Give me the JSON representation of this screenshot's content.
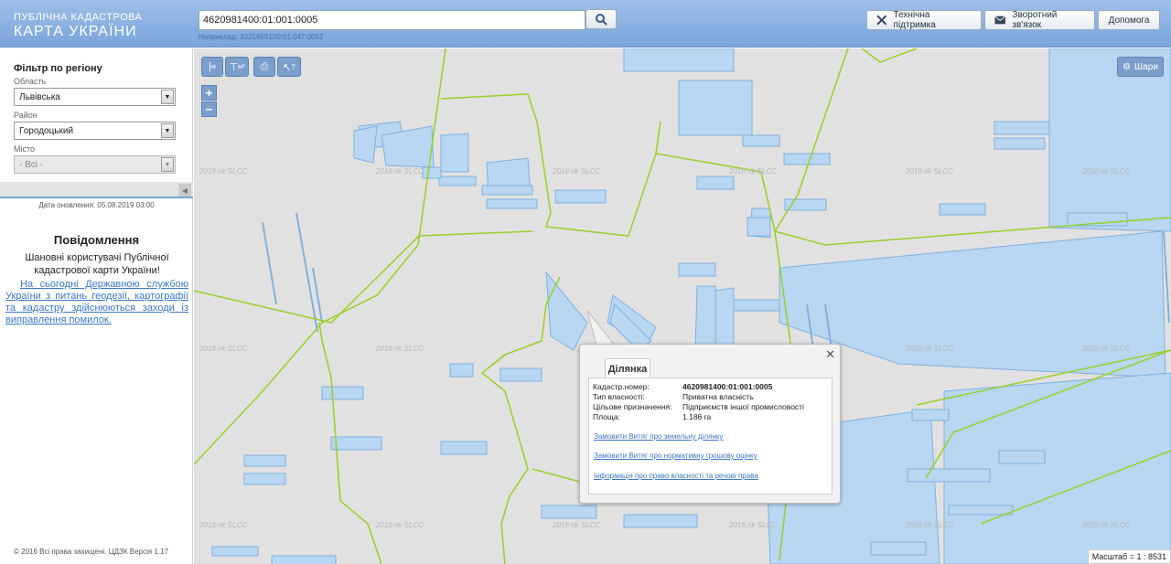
{
  "header": {
    "logo_line1": "ПУБЛІЧНА КАДАСТРОВА",
    "logo_line2": "КАРТА УКРАЇНИ",
    "search_value": "4620981400:01:001:0005",
    "hint": "Наприклад: 3221655100:01:047:0052",
    "buttons": {
      "support": "Технічна підтримка",
      "feedback": "Зворотний зв'язок",
      "help": "Допомога"
    }
  },
  "sidebar": {
    "filter_title": "Фільтр по регіону",
    "region_label": "Область",
    "region_value": "Львівська",
    "district_label": "Район",
    "district_value": "Городоцький",
    "city_label": "Місто",
    "city_value": "- Всі -",
    "update_date": "Дата оновлення: 05.08.2019 03:00",
    "notice_title": "Повідомлення",
    "notice_text": "Шановні користувачі Публічної кадастрової карти України!",
    "notice_link": "На сьогодні Державною службою України з питань геодезії, картографії та кадастру здійснюються заходи із виправлення помилок.",
    "copyright": "© 2016 Всі права захищені. ЦДЗК Версія 1.17"
  },
  "map": {
    "layers_label": "Шари",
    "scale": "Масштаб = 1 : 8531",
    "watermark": "2018 rik SLCC",
    "zoom_in": "+",
    "zoom_out": "−",
    "tools": {
      "measure_m": "м",
      "measure_area": "м²",
      "info_q": "?"
    }
  },
  "popup": {
    "tab": "Ділянка",
    "rows": [
      {
        "key": "Кадастр.номер:",
        "value": "4620981400:01:001:0005"
      },
      {
        "key": "Тип власності:",
        "value": "Приватна власність"
      },
      {
        "key": "Цільове призначення:",
        "value": "Підприємств іншої промисловості"
      },
      {
        "key": "Площа:",
        "value": "1.186 га"
      }
    ],
    "links": [
      "Замовити Витяг про земельну ділянку",
      "Замовити Витяг про нормативну грошову оцінку",
      "Інформація про право власності та речові права"
    ]
  },
  "colors": {
    "header": "#7aa4dc",
    "parcel_fill": "#b9d6f2",
    "parcel_stroke": "#7fb1e0",
    "boundary": "#9ad12e",
    "map_bg": "#e1e1e1"
  }
}
